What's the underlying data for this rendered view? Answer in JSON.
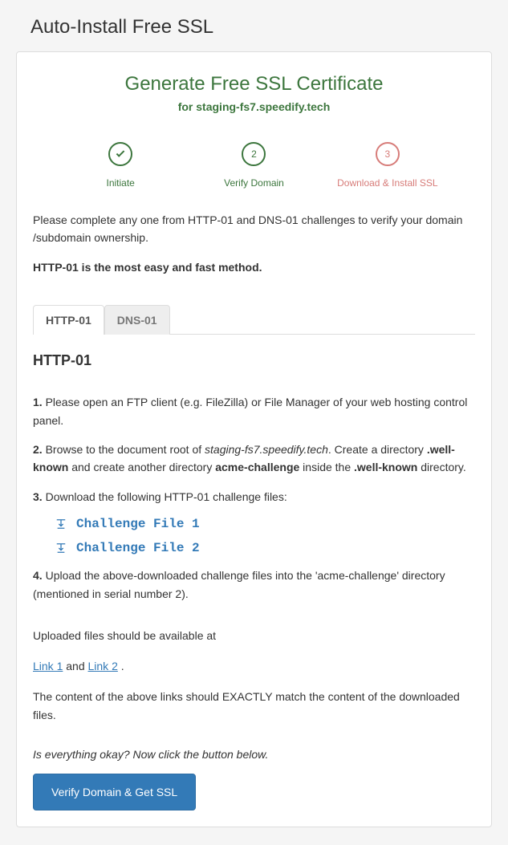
{
  "page_title": "Auto-Install Free SSL",
  "heading_main": "Generate Free SSL Certificate",
  "heading_sub_prefix": "for ",
  "domain": "staging-fs7.speedify.tech",
  "steps": [
    {
      "label": "Initiate",
      "state": "done"
    },
    {
      "label": "Verify Domain",
      "number": "2",
      "state": "current"
    },
    {
      "label": "Download & Install SSL",
      "number": "3",
      "state": "pending"
    }
  ],
  "intro_text": "Please complete any one from HTTP-01 and DNS-01 challenges to verify your domain /subdomain ownership.",
  "intro_bold": "HTTP-01 is the most easy and fast method.",
  "tabs": [
    {
      "id": "http01",
      "label": "HTTP-01",
      "active": true
    },
    {
      "id": "dns01",
      "label": "DNS-01",
      "active": false
    }
  ],
  "section_title": "HTTP-01",
  "instructions": {
    "step1_num": "1.",
    "step1_text": " Please open an FTP client (e.g. FileZilla) or File Manager of your web hosting control panel.",
    "step2_num": "2.",
    "step2_a": " Browse to the document root of ",
    "step2_domain": "staging-fs7.speedify.tech",
    "step2_b": ". Create a directory ",
    "step2_dir1": ".well-known",
    "step2_c": " and create another directory ",
    "step2_dir2": "acme-challenge",
    "step2_d": " inside the ",
    "step2_dir1b": ".well-known",
    "step2_e": " directory.",
    "step3_num": "3.",
    "step3_text": " Download the following HTTP-01 challenge files:",
    "step4_num": "4.",
    "step4_text": " Upload the above-downloaded challenge files into the 'acme-challenge' directory (mentioned in serial number 2)."
  },
  "downloads": [
    {
      "label": "Challenge File 1"
    },
    {
      "label": "Challenge File 2"
    }
  ],
  "uploaded_line": "Uploaded files should be available at",
  "links": {
    "link1": "Link 1",
    "and": " and ",
    "link2": "Link 2",
    "period": " ."
  },
  "match_line": "The content of the above links should EXACTLY match the content of the downloaded files.",
  "final_q": "Is everything okay? Now click the button below.",
  "verify_button": "Verify Domain & Get SSL",
  "colors": {
    "green": "#3c763d",
    "red": "#d77c79",
    "link": "#337ab7",
    "button_bg": "#337ab7"
  }
}
